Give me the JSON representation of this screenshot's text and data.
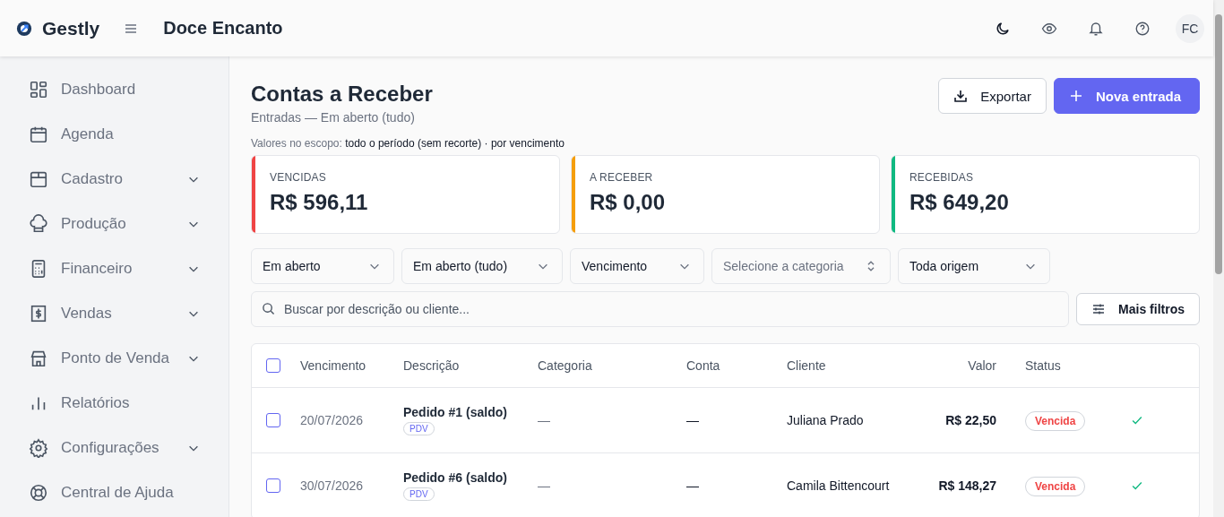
{
  "header": {
    "brand": "Gestly",
    "company": "Doce Encanto",
    "avatar": "FC"
  },
  "sidebar": {
    "items": [
      {
        "label": "Dashboard",
        "expandable": false
      },
      {
        "label": "Agenda",
        "expandable": false
      },
      {
        "label": "Cadastro",
        "expandable": true
      },
      {
        "label": "Produção",
        "expandable": true
      },
      {
        "label": "Financeiro",
        "expandable": true
      },
      {
        "label": "Vendas",
        "expandable": true
      },
      {
        "label": "Ponto de Venda",
        "expandable": true
      },
      {
        "label": "Relatórios",
        "expandable": false
      },
      {
        "label": "Configurações",
        "expandable": true
      },
      {
        "label": "Central de Ajuda",
        "expandable": false
      }
    ]
  },
  "page": {
    "title": "Contas a Receber",
    "subtitle": "Entradas — Em aberto (tudo)",
    "scope": "Valores no escopo: **todo o período (sem recorte) · por vencimento**",
    "buttons": [
      {
        "label": "Exportar",
        "kind": "secondary"
      },
      {
        "label": "Nova entrada",
        "kind": "primary"
      }
    ]
  },
  "cards": [
    {
      "label": "VENCIDAS",
      "value": "R$ 596,11",
      "color": "#ef4444"
    },
    {
      "label": "A RECEBER",
      "value": "R$ 0,00",
      "color": "#f59e0b"
    },
    {
      "label": "RECEBIDAS",
      "value": "R$ 649,20",
      "color": "#10b981"
    }
  ],
  "filters": [
    {
      "value": "Em aberto"
    },
    {
      "value": "Em aberto (tudo)"
    },
    {
      "value": "Vencimento"
    },
    {
      "placeholder": "Selecione a categoria"
    },
    {
      "value": "Toda origem"
    }
  ],
  "search": {
    "placeholder": "Buscar por descrição ou cliente..."
  },
  "more_filters": "Mais filtros",
  "table": {
    "select_all": false,
    "columns": [
      "Vencimento",
      "Descrição",
      "Categoria",
      "Conta",
      "Cliente",
      "Valor",
      "Status"
    ],
    "rows": [
      {
        "checked": false,
        "due": "20/07/2026",
        "description": "Pedido #1 (saldo)",
        "tag": "PDV",
        "category": "—",
        "account": "—",
        "client": "Juliana Prado",
        "amount": "R$ 22,50",
        "status": "Vencida"
      },
      {
        "checked": false,
        "due": "30/07/2026",
        "description": "Pedido #6 (saldo)",
        "tag": "PDV",
        "category": "—",
        "account": "—",
        "client": "Camila Bittencourt",
        "amount": "R$ 148,27",
        "status": "Vencida"
      }
    ]
  }
}
